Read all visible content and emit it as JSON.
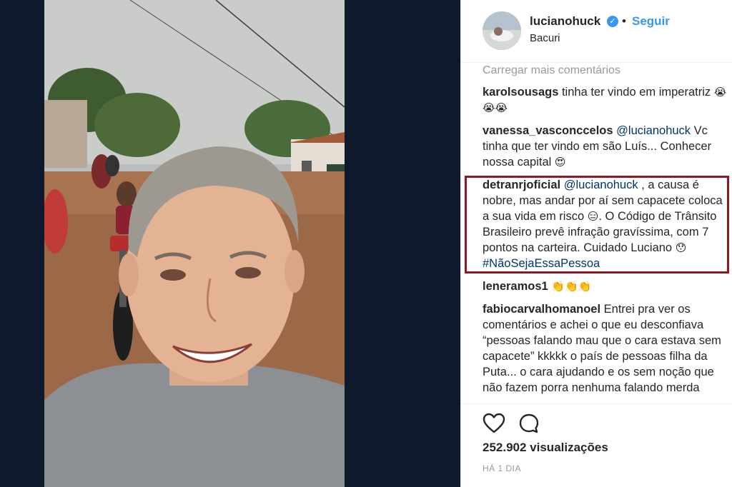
{
  "header": {
    "username": "lucianohuck",
    "verified_mark": "✓",
    "separator": "•",
    "follow_label": "Seguir",
    "location": "Bacuri"
  },
  "comments_section": {
    "load_more": "Carregar mais comentários",
    "items": [
      {
        "user": "karolsousags",
        "mention": "",
        "text": " tinha ter vindo em imperatriz ",
        "emoji": "😭😭😭",
        "text_after": ""
      },
      {
        "user": "vanessa_vasconccelos",
        "mention": "@lucianohuck",
        "text": " Vc tinha que ter vindo em são Luís... Conhecer nossa capital ",
        "emoji": "😍",
        "text_after": ""
      },
      {
        "user": "detranrjoficial",
        "mention": "@lucianohuck",
        "text": " , a causa é nobre, mas andar por aí sem capacete coloca a sua vida em risco ",
        "emoji": "😑",
        "text_after": ". O Código de Trânsito Brasileiro prevê infração gravíssima, com 7 pontos na carteira. Cuidado Luciano ",
        "emoji2": "😯",
        "hashtag": "#NãoSejaEssaPessoa"
      },
      {
        "user": "leneramos1",
        "mention": "",
        "text": " ",
        "emoji": "👏👏👏",
        "text_after": ""
      },
      {
        "user": "fabiocarvalhomanoel",
        "mention": "",
        "text": " Entrei pra ver os comentários e achei o que eu desconfiava “pessoas falando mau que o cara estava sem capacete” kkkkk o país de pessoas filha da Puta... o cara ajudando e os sem noção que não fazem porra nenhuma falando merda",
        "emoji": "",
        "text_after": ""
      }
    ]
  },
  "actions": {
    "like_icon": "heart-outline",
    "comment_icon": "speech-bubble-outline",
    "views": "252.902 visualizações",
    "timestamp": "HÁ 1 DIA"
  },
  "colors": {
    "accent": "#3897f0",
    "mention": "#003569",
    "highlight_border": "#8b1a22",
    "media_background": "#0e1a2b"
  }
}
